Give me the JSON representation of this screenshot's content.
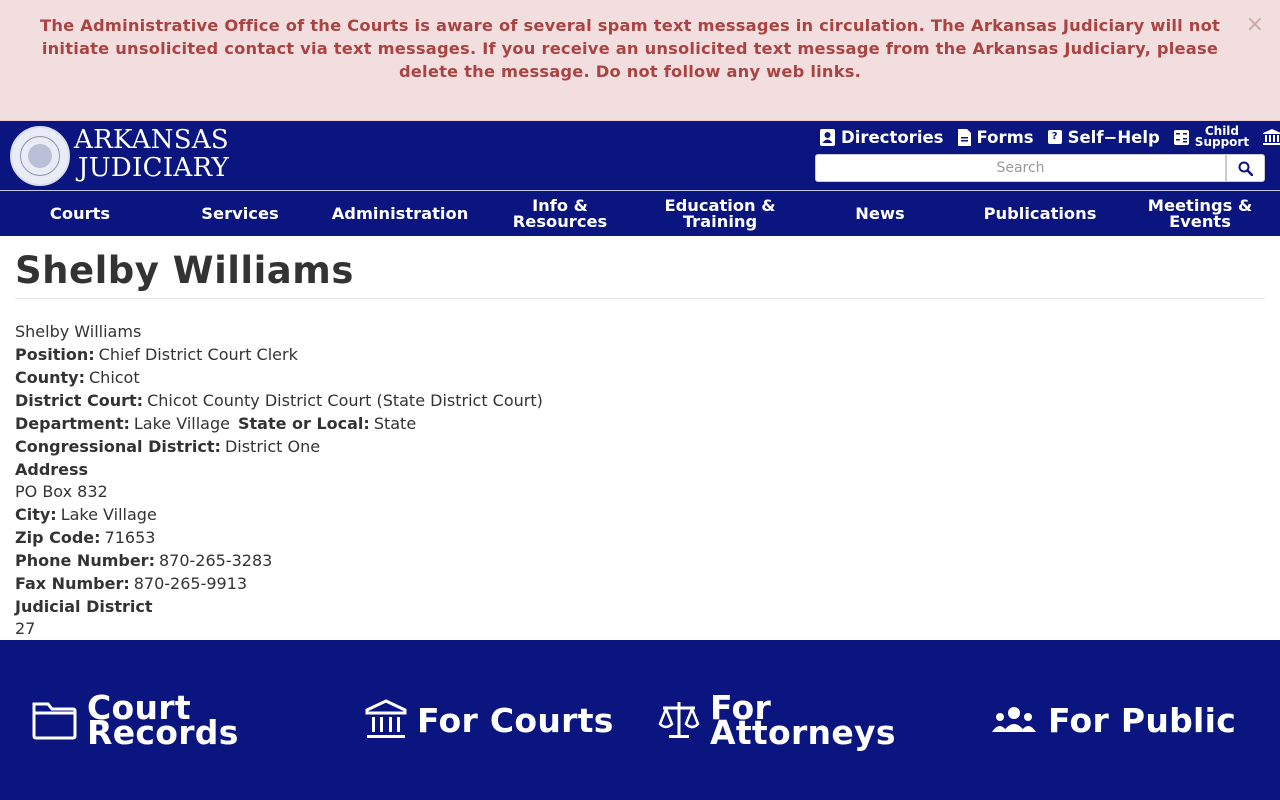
{
  "alert": {
    "message": "The Administrative Office of the Courts is aware of several spam text messages in circulation.  The Arkansas Judiciary will not initiate unsolicited contact via text messages. If you receive an unsolicited text message from the Arkansas Judiciary, please delete the message. Do not follow any web links.",
    "close": "×"
  },
  "header": {
    "logo_line1": "ARKANSAS",
    "logo_line2": "JUDICIARY",
    "util": {
      "directories": "Directories",
      "forms": "Forms",
      "self_help": "Self−Help",
      "child_1": "Child",
      "child_2": "Support",
      "more": "A"
    },
    "search_placeholder": "Search"
  },
  "nav": [
    {
      "l1": "Courts",
      "l2": ""
    },
    {
      "l1": "Services",
      "l2": ""
    },
    {
      "l1": "Administration",
      "l2": ""
    },
    {
      "l1": "Info &",
      "l2": "Resources"
    },
    {
      "l1": "Education &",
      "l2": "Training"
    },
    {
      "l1": "News",
      "l2": ""
    },
    {
      "l1": "Publications",
      "l2": ""
    },
    {
      "l1": "Meetings &",
      "l2": "Events"
    }
  ],
  "person": {
    "title": "Shelby Williams",
    "name": "Shelby Williams",
    "position_label": "Position:",
    "position": "Chief District Court Clerk",
    "county_label": "County:",
    "county": "Chicot",
    "district_court_label": "District Court:",
    "district_court": "Chicot County District Court (State District Court)",
    "department_label": "Department:",
    "department": "Lake Village",
    "state_local_label": "State or Local:",
    "state_local": "State",
    "congressional_label": "Congressional District:",
    "congressional": "District One",
    "address_label": "Address",
    "address": "PO Box 832",
    "city_label": "City:",
    "city": "Lake Village",
    "zip_label": "Zip Code:",
    "zip": "71653",
    "phone_label": "Phone Number:",
    "phone": "870-265-3283",
    "fax_label": "Fax Number:",
    "fax": "870-265-9913",
    "judicial_label": "Judicial District",
    "judicial": "27"
  },
  "footer": {
    "court_records_1": "Court",
    "court_records_2": "Records",
    "for_courts": "For Courts",
    "for_attorneys_1": "For",
    "for_attorneys_2": "Attorneys",
    "for_public": "For Public"
  },
  "colors": {
    "navy": "#0a1580",
    "alert_bg": "#f2dede",
    "alert_text": "#a94442"
  }
}
